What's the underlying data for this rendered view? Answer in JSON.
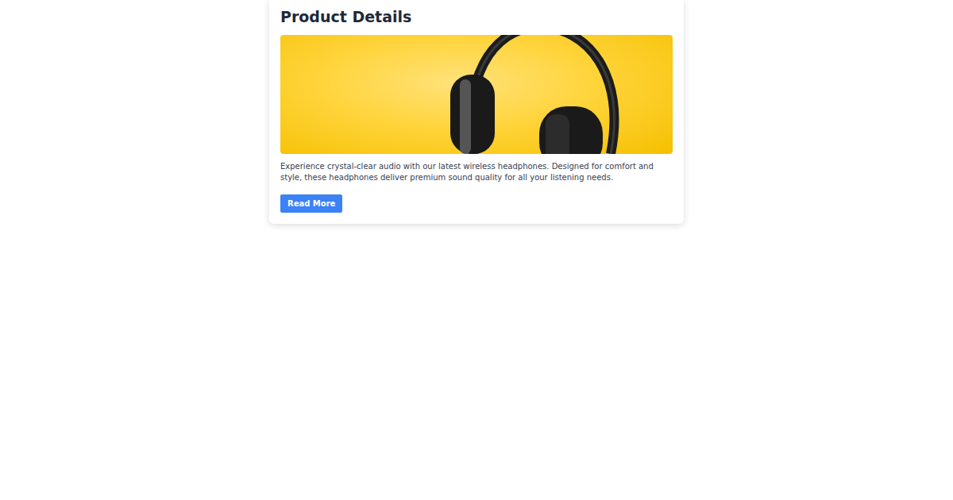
{
  "card": {
    "title": "Product Details",
    "description": "Experience crystal-clear audio with our latest wireless headphones. Designed for comfort and style, these headphones deliver premium sound quality for all your listening needs.",
    "button": "Read More"
  }
}
